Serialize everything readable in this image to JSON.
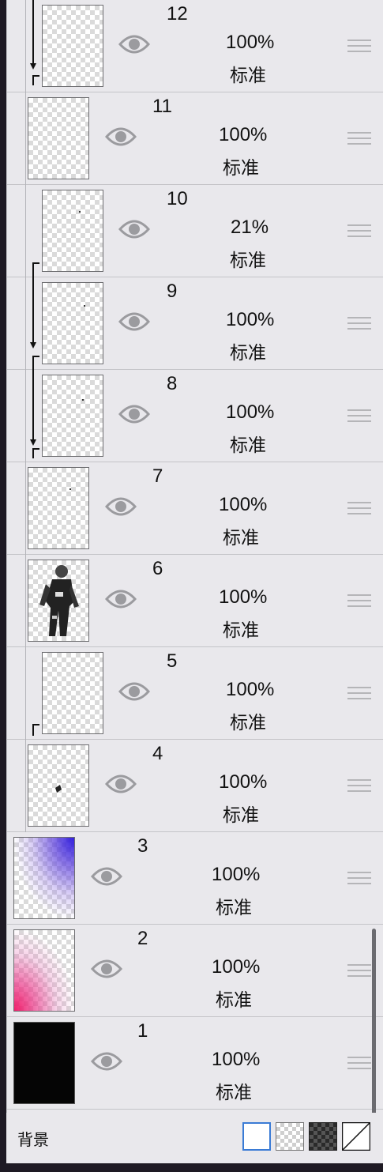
{
  "layers": [
    {
      "number": "12",
      "opacity": "100%",
      "blend": "标准",
      "clipped": true
    },
    {
      "number": "11",
      "opacity": "100%",
      "blend": "标准",
      "clipped": false
    },
    {
      "number": "10",
      "opacity": "21%",
      "blend": "标准",
      "clipped": true
    },
    {
      "number": "9",
      "opacity": "100%",
      "blend": "标准",
      "clipped": true
    },
    {
      "number": "8",
      "opacity": "100%",
      "blend": "标准",
      "clipped": true
    },
    {
      "number": "7",
      "opacity": "100%",
      "blend": "标准",
      "clipped": false
    },
    {
      "number": "6",
      "opacity": "100%",
      "blend": "标准",
      "clipped": false
    },
    {
      "number": "5",
      "opacity": "100%",
      "blend": "标准",
      "clipped": true
    },
    {
      "number": "4",
      "opacity": "100%",
      "blend": "标准",
      "clipped": false
    },
    {
      "number": "3",
      "opacity": "100%",
      "blend": "标准",
      "clipped": false
    },
    {
      "number": "2",
      "opacity": "100%",
      "blend": "标准",
      "clipped": false
    },
    {
      "number": "1",
      "opacity": "100%",
      "blend": "标准",
      "clipped": false
    }
  ],
  "footer": {
    "label": "背景",
    "swatches": [
      "white",
      "checker",
      "dark-checker",
      "transparent"
    ]
  },
  "colors": {
    "panel": "#e9e8ec",
    "eye": "#9b9b9f",
    "selected_border": "#3a7bd5",
    "layer3_tint": "#3b2fd8",
    "layer2_tint": "#f0206e"
  }
}
